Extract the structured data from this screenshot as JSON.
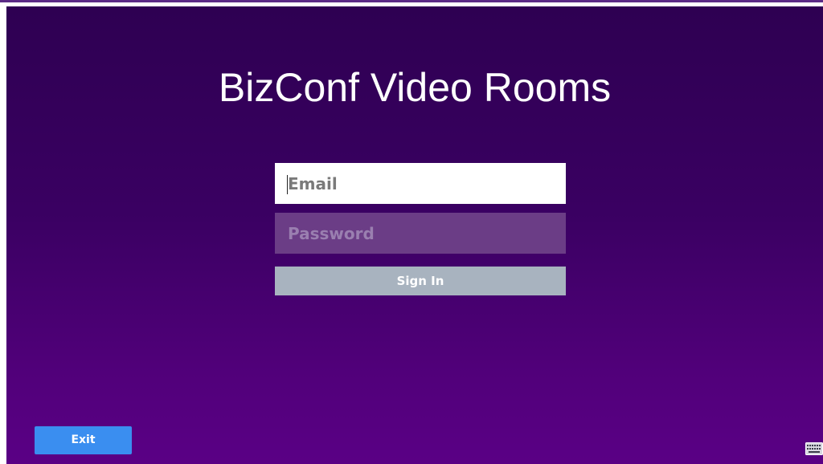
{
  "app": {
    "title": "BizConf Video Rooms"
  },
  "login": {
    "email_placeholder": "Email",
    "email_value": "",
    "password_placeholder": "Password",
    "password_value": "",
    "signin_label": "Sign In"
  },
  "footer": {
    "exit_label": "Exit",
    "keyboard_icon": "keyboard-icon"
  },
  "colors": {
    "background_top": "#2e0052",
    "background_bottom": "#5a0085",
    "signin_button": "#a8b3bf",
    "exit_button": "#3a8ef0",
    "password_field": "#6b3d86"
  }
}
